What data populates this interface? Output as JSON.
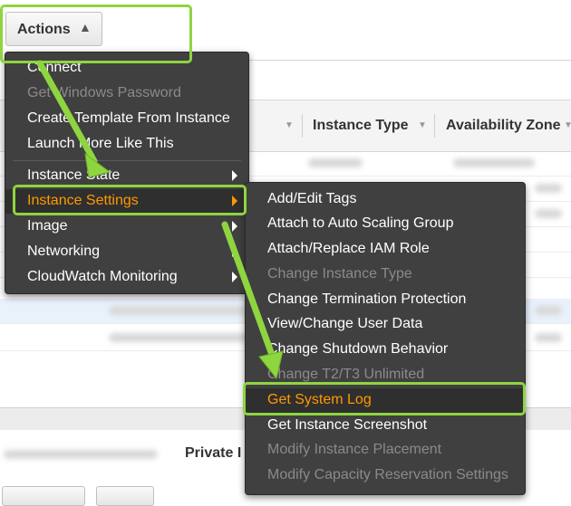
{
  "toolbar": {
    "actions_label": "Actions",
    "actions_caret": "^"
  },
  "table": {
    "columns": [
      "Instance Type",
      "Availability Zone"
    ]
  },
  "details": {
    "private_label": "Private I"
  },
  "actions_menu": {
    "items": [
      {
        "label": "Connect",
        "state": "enabled"
      },
      {
        "label": "Get Windows Password",
        "state": "disabled"
      },
      {
        "label": "Create Template From Instance",
        "state": "enabled"
      },
      {
        "label": "Launch More Like This",
        "state": "enabled"
      },
      {
        "label": "Instance State",
        "state": "enabled",
        "submenu": true
      },
      {
        "label": "Instance Settings",
        "state": "active",
        "submenu": true
      },
      {
        "label": "Image",
        "state": "enabled",
        "submenu": true
      },
      {
        "label": "Networking",
        "state": "enabled",
        "submenu": true
      },
      {
        "label": "CloudWatch Monitoring",
        "state": "enabled",
        "submenu": true
      }
    ]
  },
  "settings_submenu": {
    "items": [
      {
        "label": "Add/Edit Tags",
        "state": "enabled"
      },
      {
        "label": "Attach to Auto Scaling Group",
        "state": "enabled"
      },
      {
        "label": "Attach/Replace IAM Role",
        "state": "enabled"
      },
      {
        "label": "Change Instance Type",
        "state": "disabled"
      },
      {
        "label": "Change Termination Protection",
        "state": "enabled"
      },
      {
        "label": "View/Change User Data",
        "state": "enabled"
      },
      {
        "label": "Change Shutdown Behavior",
        "state": "enabled"
      },
      {
        "label": "Change T2/T3 Unlimited",
        "state": "disabled"
      },
      {
        "label": "Get System Log",
        "state": "active"
      },
      {
        "label": "Get Instance Screenshot",
        "state": "enabled"
      },
      {
        "label": "Modify Instance Placement",
        "state": "disabled"
      },
      {
        "label": "Modify Capacity Reservation Settings",
        "state": "disabled"
      }
    ]
  },
  "colors": {
    "menu_bg": "#404040",
    "menu_text": "#ffffff",
    "menu_disabled": "#8a8a8a",
    "active_orange": "#ff9900",
    "highlight_green": "#8ed53f"
  }
}
